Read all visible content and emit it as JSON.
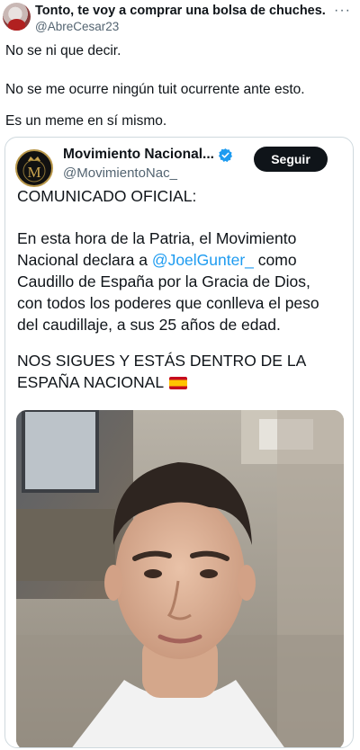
{
  "tweet": {
    "author_name": "Tonto, te voy a comprar una bolsa de chuches.",
    "author_handle": "@AbreCesar23",
    "more_icon": "more-horizontal-icon",
    "lines": [
      "No se ni que decir.",
      "No se me ocurre ningún tuit ocurrente ante esto.",
      "Es un meme en sí mismo."
    ]
  },
  "quote": {
    "name": "Movimiento Nacional...",
    "handle": "@MovimientoNac_",
    "follow_label": "Seguir",
    "verified_icon": "verified-badge-icon",
    "heading": "COMUNICADO OFICIAL:",
    "para1_line1": "En esta hora de la Patria, el Movimiento",
    "para1_line2_a": "Nacional declara a ",
    "mention": "@JoelGunter_",
    "para1_line2_b": " como",
    "para1_line3": "Caudillo de España por la Gracia de Dios,",
    "para1_line4": "con todos los poderes que conlleva el peso",
    "para1_line5": "del caudillaje, a sus 25 años de edad.",
    "para2_line1": "NOS SIGUES Y ESTÁS DENTRO DE LA",
    "para2_line2": "ESPAÑA NACIONAL",
    "flag_icon": "spain-flag-icon",
    "avatar_letter": "M"
  },
  "colors": {
    "mention": "#1d9bf0",
    "verified": "#1d9bf0",
    "follow_bg": "#0f1419",
    "secondary_text": "#536471"
  }
}
